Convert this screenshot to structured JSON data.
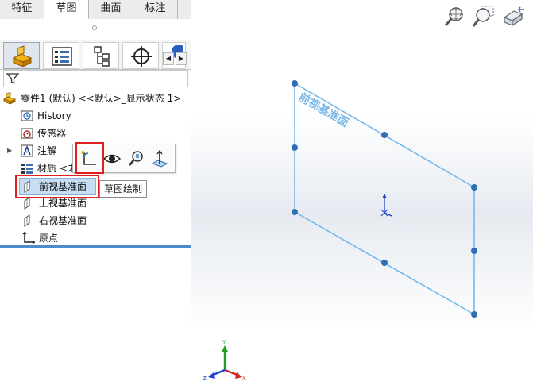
{
  "command_tabs": [
    {
      "label": "特征"
    },
    {
      "label": "草图"
    },
    {
      "label": "曲面"
    },
    {
      "label": "标注"
    },
    {
      "label": "评估"
    }
  ],
  "active_tab": "草图",
  "feature_tree": {
    "root_label": "零件1 (默认) <<默认>_显示状态 1>",
    "items": [
      {
        "label": "History",
        "icon": "history-icon"
      },
      {
        "label": "传感器",
        "icon": "sensor-icon"
      },
      {
        "label": "注解",
        "icon": "annotation-icon"
      },
      {
        "label": "材质 <未指定>",
        "icon": "material-icon"
      },
      {
        "label": "前视基准面",
        "icon": "plane-icon"
      },
      {
        "label": "上视基准面",
        "icon": "plane-icon"
      },
      {
        "label": "右视基准面",
        "icon": "plane-icon"
      },
      {
        "label": "原点",
        "icon": "origin-icon"
      }
    ]
  },
  "context_toolbar": {
    "buttons": [
      {
        "name": "sketch-button",
        "icon": "sketch-icon"
      },
      {
        "name": "hide-show-button",
        "icon": "eye-icon"
      },
      {
        "name": "zoom-to-selection-button",
        "icon": "zoom-selection-icon"
      },
      {
        "name": "normal-to-button",
        "icon": "normal-to-icon"
      }
    ]
  },
  "tooltip": {
    "text": "草图绘制"
  },
  "viewport": {
    "plane_label": "前视基准面",
    "triad": {
      "x": "X",
      "y": "Y",
      "z": "Z"
    }
  },
  "colors": {
    "selection": "#6fb6ea",
    "highlight_box": "#e02020",
    "triad_x": "#d02020",
    "triad_y": "#20a020",
    "triad_z": "#2040d0"
  }
}
